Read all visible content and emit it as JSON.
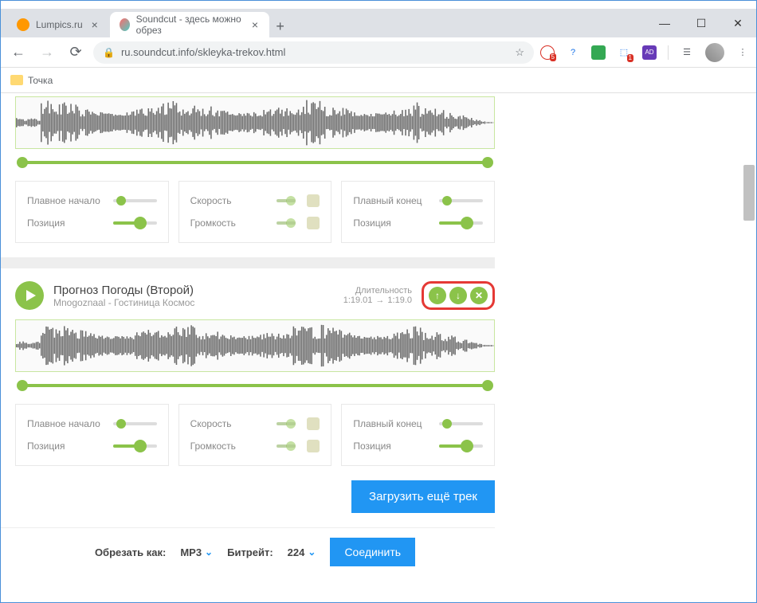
{
  "browser": {
    "tabs": [
      {
        "title": "Lumpics.ru",
        "active": false
      },
      {
        "title": "Soundcut - здесь можно обрез",
        "active": true
      }
    ],
    "url": "ru.soundcut.info/skleyka-trekov.html",
    "bookmark": "Точка",
    "ext_badges": {
      "shield": "5",
      "cube": "1"
    }
  },
  "track1": {
    "controls": {
      "fade_in": "Плавное начало",
      "position": "Позиция",
      "speed": "Скорость",
      "volume": "Громкость",
      "fade_out": "Плавный конец",
      "position2": "Позиция"
    }
  },
  "track2": {
    "title": "Прогноз Погоды (Второй)",
    "artist": "Mnogoznaal - Гостиница Космос",
    "duration_label": "Длительность",
    "time_start": "1:19.01",
    "time_end": "1:19.0",
    "controls": {
      "fade_in": "Плавное начало",
      "position": "Позиция",
      "speed": "Скорость",
      "volume": "Громкость",
      "fade_out": "Плавный конец",
      "position2": "Позиция"
    }
  },
  "buttons": {
    "upload": "Загрузить ещё трек",
    "join": "Соединить"
  },
  "footer": {
    "cut_as": "Обрезать как:",
    "format": "MP3",
    "bitrate_label": "Битрейт:",
    "bitrate": "224"
  }
}
